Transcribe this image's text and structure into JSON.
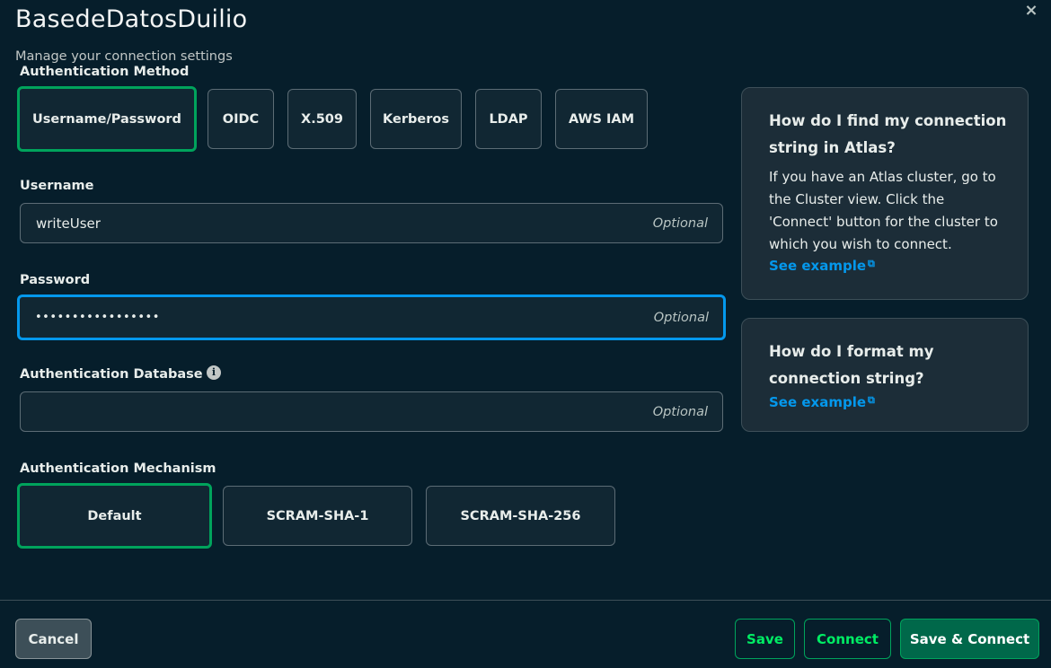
{
  "header": {
    "title": "BasedeDatosDuilio",
    "subtitle": "Manage your connection settings",
    "close_icon": "×"
  },
  "auth_method": {
    "label": "Authentication Method",
    "selected": "Username/Password",
    "options": [
      "Username/Password",
      "OIDC",
      "X.509",
      "Kerberos",
      "LDAP",
      "AWS IAM"
    ]
  },
  "username": {
    "label": "Username",
    "value": "writeUser",
    "hint": "Optional"
  },
  "password": {
    "label": "Password",
    "value": "•••••••••••••••••",
    "hint": "Optional"
  },
  "auth_database": {
    "label": "Authentication Database",
    "value": "",
    "hint": "Optional",
    "info_icon": "i"
  },
  "auth_mechanism": {
    "label": "Authentication Mechanism",
    "selected": "Default",
    "options": [
      "Default",
      "SCRAM-SHA-1",
      "SCRAM-SHA-256"
    ]
  },
  "help": {
    "card1": {
      "title": "How do I find my connection string in Atlas?",
      "body": "If you have an Atlas cluster, go to the Cluster view. Click the 'Connect' button for the cluster to which you wish to connect.",
      "link": "See example"
    },
    "card2": {
      "title": "How do I format my connection string?",
      "link": "See example"
    },
    "external_link_icon": "⧉"
  },
  "footer": {
    "cancel": "Cancel",
    "save": "Save",
    "connect": "Connect",
    "save_connect": "Save & Connect"
  },
  "colors": {
    "background": "#061e2b",
    "selected_border": "#00a35c",
    "focus_border": "#0498ec",
    "link": "#0498ec",
    "primary_button": "#00684a",
    "outline_button_text": "#00ed64"
  }
}
